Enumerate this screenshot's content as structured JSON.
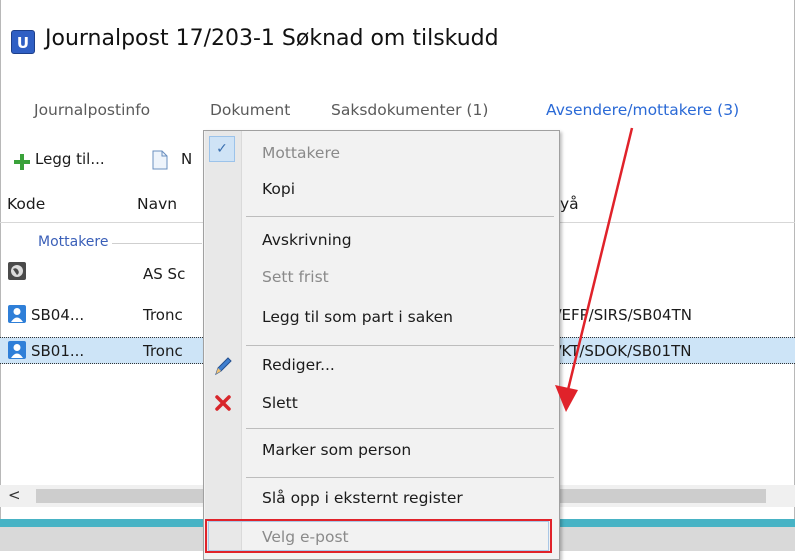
{
  "window": {
    "title": "Journalpost 17/203-1 Søknad om tilskudd",
    "icon_letter": "U"
  },
  "tabs": [
    {
      "label": "Journalpostinfo",
      "active": false
    },
    {
      "label": "Dokument",
      "active": false
    },
    {
      "label": "Saksdokumenter (1)",
      "active": false
    },
    {
      "label": "Avsendere/mottakere (3)",
      "active": true
    }
  ],
  "toolbar": {
    "add_label": "Legg til...",
    "second_label": "N"
  },
  "table": {
    "headers": [
      "Kode",
      "Navn",
      "yå"
    ],
    "group_label": "Mottakere",
    "rows": [
      {
        "kode": "",
        "navn": "AS Sc",
        "unit": "",
        "icon": "globe-icon",
        "selected": false
      },
      {
        "kode": "SB04...",
        "navn": "Tronc",
        "unit": "E/EFP/SIRS/SB04TN",
        "icon": "user-icon",
        "selected": false
      },
      {
        "kode": "SB01...",
        "navn": "Tronc",
        "unit": "E/KT/SDOK/SB01TN",
        "icon": "user-icon",
        "selected": true
      }
    ]
  },
  "scrollbar": {
    "left_arrow": "<"
  },
  "context_menu": {
    "items": [
      {
        "label": "Mottakere",
        "disabled": true,
        "checked": true
      },
      {
        "label": "Kopi",
        "disabled": false
      },
      {
        "label": "Avskrivning",
        "disabled": false
      },
      {
        "label": "Sett frist",
        "disabled": true
      },
      {
        "label": "Legg til som part i saken",
        "disabled": false
      },
      {
        "label": "Rediger...",
        "disabled": false,
        "icon": "pencil-icon"
      },
      {
        "label": "Slett",
        "disabled": false,
        "icon": "delete-x-icon"
      },
      {
        "label": "Marker som person",
        "disabled": false
      },
      {
        "label": "Slå opp i eksternt register",
        "disabled": false
      },
      {
        "label": "Velg e-post",
        "disabled": true,
        "highlighted": true
      }
    ],
    "check_glyph": "✓"
  },
  "annotation": {
    "arrow_color": "#e0222a",
    "box_color": "#e0222a"
  }
}
